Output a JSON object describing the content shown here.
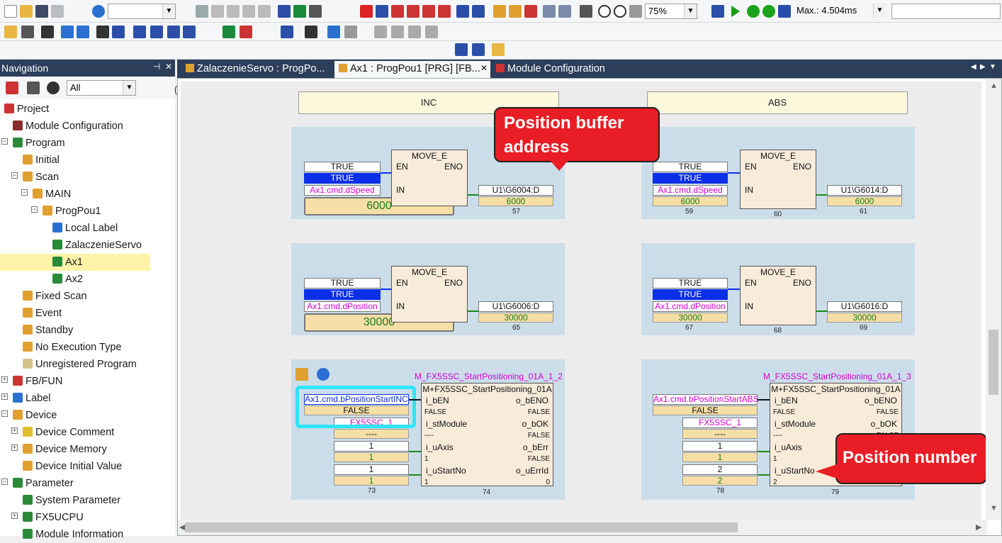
{
  "toolbar": {
    "zoom": "75%",
    "scan_time": "Max.: 4.504ms"
  },
  "nav": {
    "title": "Navigation",
    "filter": "All",
    "items": [
      {
        "label": "Project"
      },
      {
        "label": "Module Configuration"
      },
      {
        "label": "Program"
      },
      {
        "label": "Initial"
      },
      {
        "label": "Scan"
      },
      {
        "label": "MAIN"
      },
      {
        "label": "ProgPou1"
      },
      {
        "label": "Local Label"
      },
      {
        "label": "ZalaczenieServo"
      },
      {
        "label": "Ax1"
      },
      {
        "label": "Ax2"
      },
      {
        "label": "Fixed Scan"
      },
      {
        "label": "Event"
      },
      {
        "label": "Standby"
      },
      {
        "label": "No Execution Type"
      },
      {
        "label": "Unregistered Program"
      },
      {
        "label": "FB/FUN"
      },
      {
        "label": "Label"
      },
      {
        "label": "Device"
      },
      {
        "label": "Device Comment"
      },
      {
        "label": "Device Memory"
      },
      {
        "label": "Device Initial Value"
      },
      {
        "label": "Parameter"
      },
      {
        "label": "System Parameter"
      },
      {
        "label": "FX5UCPU"
      },
      {
        "label": "Module Information"
      }
    ]
  },
  "tabs": [
    {
      "label": "ZalaczenieServo : ProgPo..."
    },
    {
      "label": "Ax1 : ProgPou1 [PRG] [FB..."
    },
    {
      "label": "Module Configuration"
    }
  ],
  "ladder": {
    "inc_header": "INC",
    "abs_header": "ABS",
    "true_label": "TRUE",
    "false_label": "FALSE",
    "move_title": "MOVE_E",
    "en": "EN",
    "eno": "ENO",
    "in": "IN",
    "inc_speed": {
      "var": "Ax1.cmd.dSpeed",
      "value": "6000",
      "out": "U1\\G6004:D",
      "out_val": "6000",
      "step": "57"
    },
    "abs_speed": {
      "var": "Ax1.cmd.dSpeed",
      "value": "6000",
      "out": "U1\\G6014:D",
      "out_val": "6000",
      "step_in": "59",
      "step": "60",
      "step_out": "61"
    },
    "inc_pos": {
      "var": "Ax1.cmd.dPosition",
      "value": "30000",
      "out": "U1\\G6006:D",
      "out_val": "30000",
      "step": "65"
    },
    "abs_pos": {
      "var": "Ax1.cmd.dPosition",
      "value": "30000",
      "out": "U1\\G6016:D",
      "out_val": "30000",
      "step_in": "67",
      "step": "68",
      "step_out": "69"
    },
    "inc_fb": {
      "instance": "M_FX5SSC_StartPositioning_01A_1_2",
      "type": "M+FX5SSC_StartPositioning_01A",
      "start_var": "Ax1.cmd.bPositionStartINC",
      "module": "FX5SSC_1",
      "axis": "1",
      "axis_val": "1",
      "start_no": "1",
      "start_no_val": "1",
      "step_in": "73",
      "step": "74"
    },
    "abs_fb": {
      "instance": "M_FX5SSC_StartPositioning_01A_1_3",
      "type": "M+FX5SSC_StartPositioning_01A",
      "start_var": "Ax1.cmd.bPositionStartABS",
      "module": "FX5SSC_1",
      "axis": "1",
      "axis_val": "1",
      "start_no": "2",
      "start_no_val": "2",
      "step_in": "78",
      "step": "79"
    },
    "pins": {
      "i_bEN": "i_bEN",
      "o_bENO": "o_bENO",
      "i_stModule": "i_stModule",
      "o_bOK": "o_bOK",
      "i_uAxis": "i_uAxis",
      "o_bErr": "o_bErr",
      "i_uStartNo": "i_uStartNo",
      "o_uErrId": "o_uErrId",
      "dash": "----",
      "zero": "0",
      "one": "1"
    }
  },
  "callouts": {
    "buffer": "Position buffer address",
    "number": "Position number"
  }
}
